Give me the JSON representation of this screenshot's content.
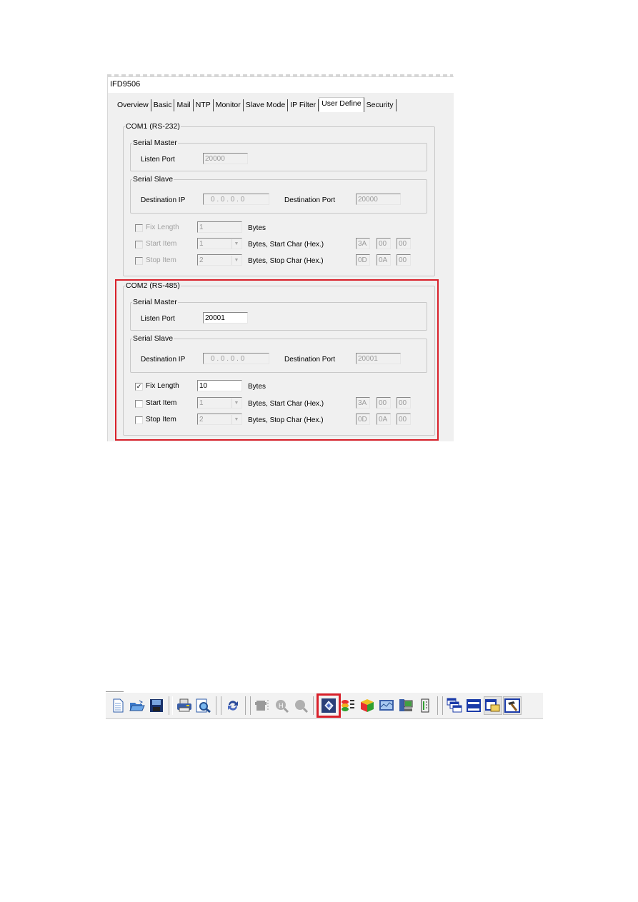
{
  "window": {
    "title": "IFD9506",
    "tabs": [
      {
        "label": "Overview",
        "active": false
      },
      {
        "label": "Basic",
        "active": false
      },
      {
        "label": "Mail",
        "active": false
      },
      {
        "label": "NTP",
        "active": false
      },
      {
        "label": "Monitor",
        "active": false
      },
      {
        "label": "Slave Mode",
        "active": false
      },
      {
        "label": "IP Filter",
        "active": false
      },
      {
        "label": "User Define",
        "active": true
      },
      {
        "label": "Security",
        "active": false
      }
    ]
  },
  "com1": {
    "legend": "COM1 (RS-232)",
    "serial_master": {
      "legend": "Serial Master",
      "listen_port_label": "Listen Port",
      "listen_port_value": "20000"
    },
    "serial_slave": {
      "legend": "Serial Slave",
      "dest_ip_label": "Destination IP",
      "dest_ip_value": "0  .  0  .  0  .  0",
      "dest_port_label": "Destination Port",
      "dest_port_value": "20000"
    },
    "fix_length": {
      "label": "Fix Length",
      "checked": false,
      "value": "1",
      "unit": "Bytes"
    },
    "start_item": {
      "label": "Start Item",
      "checked": false,
      "value": "1",
      "unit": "Bytes,  Start Char (Hex.)",
      "chars": [
        "3A",
        "00",
        "00"
      ]
    },
    "stop_item": {
      "label": "Stop Item",
      "checked": false,
      "value": "2",
      "unit": "Bytes,  Stop Char (Hex.)",
      "chars": [
        "0D",
        "0A",
        "00"
      ]
    }
  },
  "com2": {
    "legend": "COM2 (RS-485)",
    "serial_master": {
      "legend": "Serial Master",
      "listen_port_label": "Listen Port",
      "listen_port_value": "20001"
    },
    "serial_slave": {
      "legend": "Serial Slave",
      "dest_ip_label": "Destination IP",
      "dest_ip_value": "0  .  0  .  0  .  0",
      "dest_port_label": "Destination Port",
      "dest_port_value": "20001"
    },
    "fix_length": {
      "label": "Fix Length",
      "checked": true,
      "check_mark": "✓",
      "value": "10",
      "unit": "Bytes"
    },
    "start_item": {
      "label": "Start Item",
      "checked": false,
      "value": "1",
      "unit": "Bytes,  Start Char (Hex.)",
      "chars": [
        "3A",
        "00",
        "00"
      ]
    },
    "stop_item": {
      "label": "Stop Item",
      "checked": false,
      "value": "2",
      "unit": "Bytes,  Stop Char (Hex.)",
      "chars": [
        "0D",
        "0A",
        "00"
      ]
    }
  },
  "dropdown_arrow": "▼",
  "toolbar": {
    "buttons": [
      {
        "name": "new-document-icon",
        "enabled": true
      },
      {
        "name": "open-folder-icon",
        "enabled": true
      },
      {
        "name": "save-disk-icon",
        "enabled": true
      },
      {
        "name": "print-icon",
        "enabled": true
      },
      {
        "name": "print-preview-icon",
        "enabled": true
      },
      {
        "name": "refresh-icon",
        "enabled": true
      },
      {
        "name": "device-icon",
        "enabled": false
      },
      {
        "name": "search-h-icon",
        "enabled": false
      },
      {
        "name": "search-icon",
        "enabled": false
      },
      {
        "name": "ifd-config-icon",
        "enabled": true,
        "highlighted": true
      },
      {
        "name": "network-stack-icon",
        "enabled": true
      },
      {
        "name": "cube-icon",
        "enabled": true
      },
      {
        "name": "monitor-chart-icon",
        "enabled": true
      },
      {
        "name": "computer-icon",
        "enabled": true
      },
      {
        "name": "io-module-icon",
        "enabled": true
      },
      {
        "name": "cascade-windows-icon",
        "enabled": true
      },
      {
        "name": "tile-horizontal-icon",
        "enabled": true
      },
      {
        "name": "tile-vertical-icon",
        "enabled": true,
        "pressed": true
      },
      {
        "name": "tool-hammer-icon",
        "enabled": true,
        "pressed": true
      }
    ]
  },
  "colors": {
    "highlight": "#d9202a",
    "dialog_bg": "#f0f0f0"
  }
}
